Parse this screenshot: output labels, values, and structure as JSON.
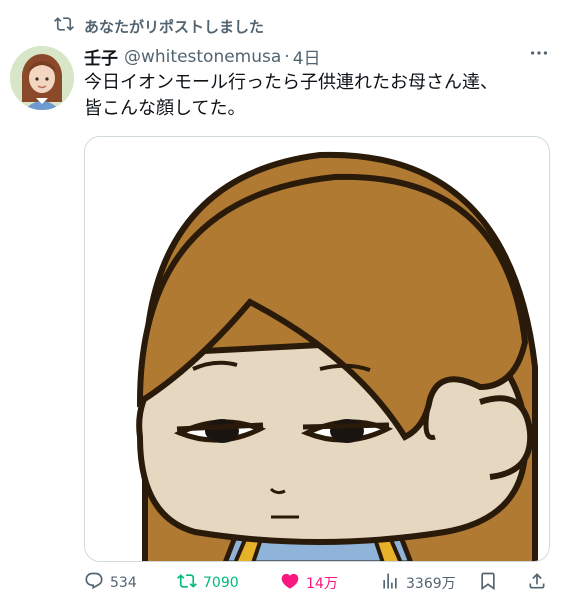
{
  "repost": {
    "label": "あなたがリポストしました",
    "icon": "repost-icon"
  },
  "author": {
    "name": "壬子",
    "handle": "@whitestonemusa",
    "separator": "·",
    "time": "4日"
  },
  "tweet": {
    "lines": [
      "今日イオンモール行ったら子供連れたお母さん達、",
      "皆こんな顔してた。"
    ]
  },
  "actions": {
    "replies": "534",
    "reposts": "7090",
    "likes": "14万",
    "views": "3369万"
  },
  "colors": {
    "muted": "#536471",
    "repost_green": "#00ba7c",
    "like_pink": "#f91880",
    "border": "#cfd9de",
    "hair": "#b07a33",
    "skin": "#e6d7c0"
  }
}
